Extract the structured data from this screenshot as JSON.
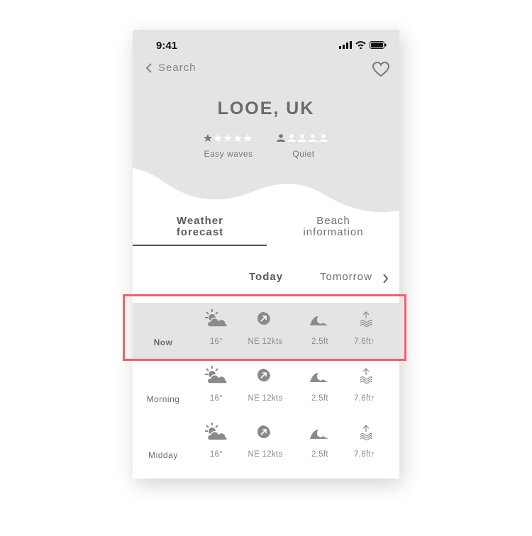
{
  "status_bar": {
    "time": "9:41"
  },
  "nav": {
    "back_label": "Search"
  },
  "location": {
    "title": "LOOE, UK"
  },
  "ratings": [
    {
      "label": "Easy waves",
      "filled": 1,
      "total": 5,
      "icon": "star-icon"
    },
    {
      "label": "Quiet",
      "filled": 1,
      "total": 5,
      "icon": "person-icon"
    }
  ],
  "tabs": [
    {
      "label_line1": "Weather",
      "label_line2": "forecast",
      "active": true
    },
    {
      "label_line1": "Beach",
      "label_line2": "information",
      "active": false
    }
  ],
  "days": {
    "today": "Today",
    "tomorrow": "Tomorrow"
  },
  "forecast": [
    {
      "label": "Now",
      "temp": "16°",
      "wind": "NE 12kts",
      "wave": "2.5ft",
      "tide": "7.6ft",
      "highlight": true
    },
    {
      "label": "Morning",
      "temp": "16°",
      "wind": "NE 12kts",
      "wave": "2.5ft",
      "tide": "7.6ft",
      "highlight": false
    },
    {
      "label": "Midday",
      "temp": "16°",
      "wind": "NE 12kts",
      "wave": "2.5ft",
      "tide": "7.6ft",
      "highlight": false
    }
  ],
  "colors": {
    "hero_bg": "#e4e4e4",
    "highlight_border": "#f0606a",
    "text": "#6f6f6f"
  }
}
